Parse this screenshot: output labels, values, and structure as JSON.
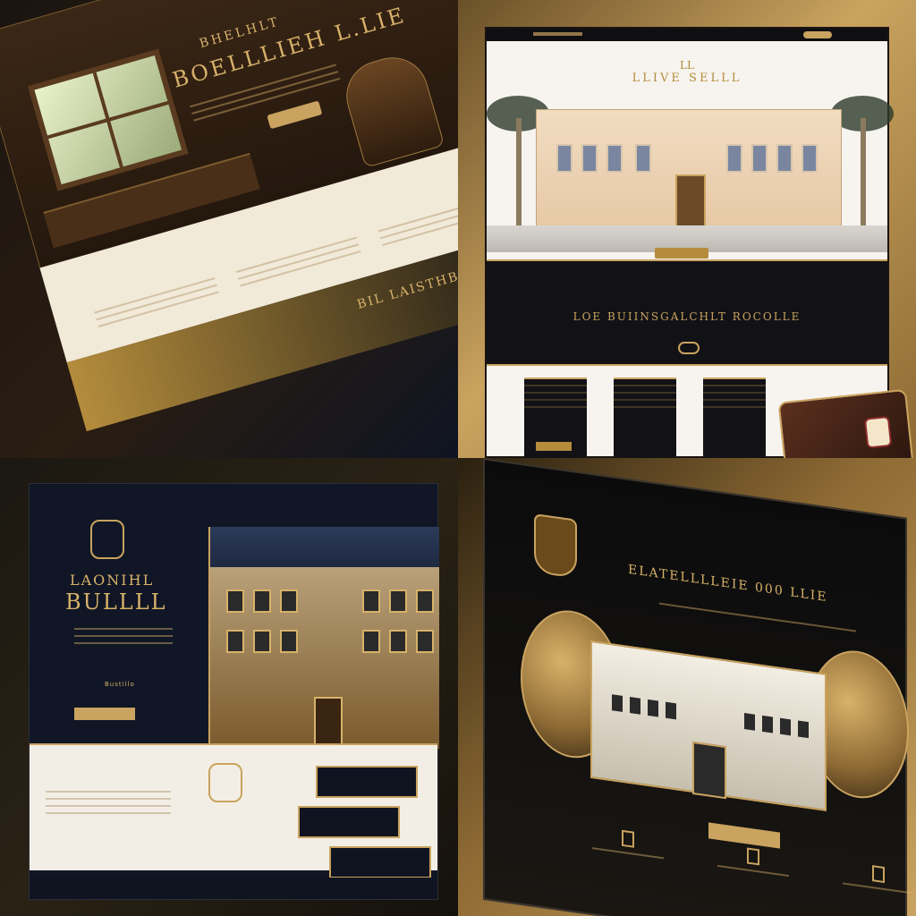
{
  "grid_title": "",
  "panels": [
    {
      "name": "desk-theme",
      "hero_title": "BOELLLIEH L.LIE",
      "hero_sup": "BHELHLT",
      "nav": [
        "",
        "",
        "",
        "",
        "",
        ""
      ],
      "cta": "",
      "section_title": "",
      "bottom_title": "BIL LAISTHBET",
      "colors": {
        "gold": "#d8b26a",
        "cream": "#f2ead8",
        "dark": "#1a1410"
      }
    },
    {
      "name": "estate-theme",
      "monogram": "LL",
      "brand": "LLIVE SELLL",
      "nav": [
        "",
        "",
        "",
        "",
        "",
        ""
      ],
      "hero_cta": "",
      "dark_section_title": "LOE BUIINSGALCHLT ROCOLLE",
      "form_labels": [
        "",
        "",
        ""
      ],
      "submit": "",
      "colors": {
        "gold": "#c9a35f",
        "cream": "#f7f4ef",
        "dark": "#121216"
      }
    },
    {
      "name": "manor-theme",
      "title_top": "LAONIHL",
      "title_main": "BULLLL",
      "subtitle": "Bustillo",
      "cta": "",
      "footer_label": "",
      "colors": {
        "gold": "#c9a35f",
        "navy": "#101625",
        "cream": "#f3eee5"
      }
    },
    {
      "name": "lion-theme",
      "hero_title": "ELATELLLLEIE 000 LLIE",
      "subtitle": "",
      "cta": "",
      "columns": [
        "",
        "",
        ""
      ],
      "colors": {
        "gold": "#c9a35f",
        "dark": "#0b0b0c",
        "stone": "#f3eee3"
      }
    }
  ]
}
